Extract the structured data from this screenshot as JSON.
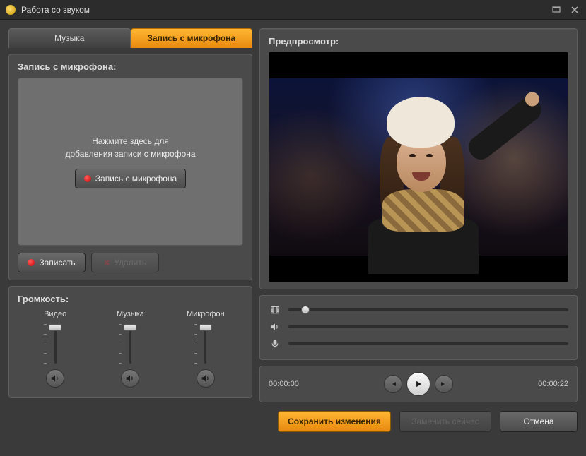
{
  "window": {
    "title": "Работа со звуком"
  },
  "tabs": {
    "music": "Музыка",
    "mic": "Запись с микрофона"
  },
  "mic_panel": {
    "title": "Запись с микрофона:",
    "hint_line1": "Нажмите здесь для",
    "hint_line2": "добавления записи с микрофона",
    "record_btn": "Запись с микрофона",
    "record2_btn": "Записать",
    "delete_btn": "Удалить"
  },
  "volume": {
    "title": "Громкость:",
    "video": "Видео",
    "music": "Музыка",
    "mic": "Микрофон"
  },
  "preview": {
    "title": "Предпросмотр:"
  },
  "transport": {
    "left_time": "00:00:00",
    "right_time": "00:00:22"
  },
  "footer": {
    "save": "Сохранить изменения",
    "replace": "Заменить сейчас",
    "cancel": "Отмена"
  }
}
